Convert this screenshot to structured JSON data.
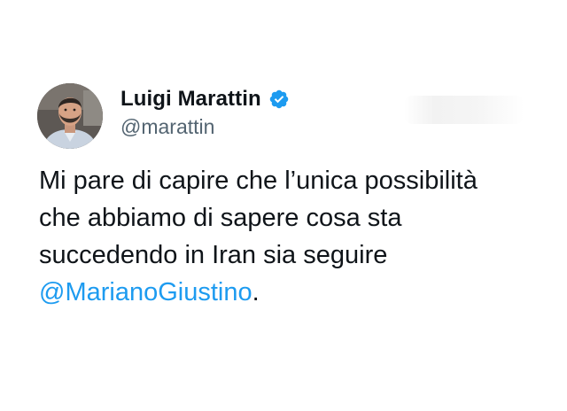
{
  "author": {
    "display_name": "Luigi Marattin",
    "handle": "@marattin",
    "verified": true
  },
  "tweet": {
    "lines": [
      "Mi pare di capire che l’unica possibilità",
      "che abbiamo di sapere cosa sta",
      "succedendo in Iran sia seguire"
    ],
    "mention": "@MarianoGiustino",
    "end_punctuation": "."
  },
  "colors": {
    "text": "#0f1419",
    "secondary_text": "#536471",
    "accent": "#1d9bf0"
  },
  "icons": {
    "verified": "verified-badge-icon",
    "avatar": "profile-photo"
  }
}
